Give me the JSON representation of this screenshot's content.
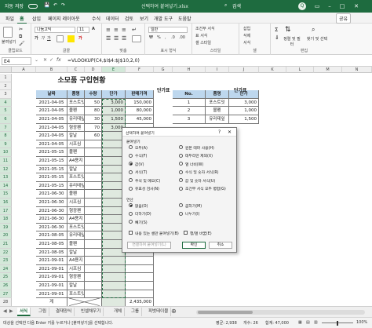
{
  "titlebar": {
    "autosave": "자동 저장",
    "filename": "선택하여 붙여넣기.xlsx",
    "search": "검색",
    "user_initial": "Q"
  },
  "menu": {
    "tabs": [
      "파일",
      "홈",
      "삽입",
      "페이지 레이아웃",
      "수식",
      "데이터",
      "검토",
      "보기",
      "개발 도구",
      "도움말"
    ],
    "active": 1,
    "share": "공유"
  },
  "ribbon": {
    "clipboard_label": "클립보드",
    "paste": "붙여넣기",
    "font_label": "글꼴",
    "font_name": "나눔고딕",
    "font_size": "11",
    "align_label": "맞춤",
    "number_label": "표시 형식",
    "number_format": "일반",
    "style_label": "스타일",
    "cond_format": "조건부 서식",
    "table_format": "표 서식",
    "cell_style": "셀 스타일",
    "cells_label": "셀",
    "insert": "삽입",
    "delete": "삭제",
    "format": "서식",
    "edit_label": "편집",
    "sort": "정렬 및 필터",
    "find": "찾기 및 선택"
  },
  "formula_bar": {
    "name_box": "E4",
    "fx": "fx",
    "formula": "=VLOOKUP(C4,$I$4:$J$10,2,0)"
  },
  "columns": [
    "A",
    "B",
    "C",
    "D",
    "E",
    "F",
    "G",
    "H",
    "I",
    "J",
    "K",
    "L",
    "M",
    "N"
  ],
  "sheet": {
    "title": "소모품 구입현황",
    "headers": [
      "날짜",
      "품명",
      "수량",
      "단가",
      "판매가격"
    ],
    "rows": [
      [
        "2021-04-05",
        "포스트잇",
        "50",
        "3,000",
        "150,000"
      ],
      [
        "2021-04-05",
        "볼펜",
        "80",
        "1,000",
        "80,000"
      ],
      [
        "2021-04-05",
        "유리테잎",
        "30",
        "1,500",
        "45,000"
      ],
      [
        "2021-04-05",
        "형광펜",
        "70",
        "3,000",
        ""
      ],
      [
        "2021-04-05",
        "칼날",
        "60",
        "",
        ""
      ],
      [
        "2021-04-05",
        "시프심",
        "",
        "",
        ""
      ],
      [
        "2021-05-15",
        "볼펜",
        "",
        "",
        ""
      ],
      [
        "2021-05-15",
        "A4용지",
        "",
        "",
        ""
      ],
      [
        "2021-05-15",
        "칼날",
        "",
        "",
        ""
      ],
      [
        "2021-05-15",
        "포스트잇",
        "",
        "",
        ""
      ],
      [
        "2021-05-15",
        "유리테잎",
        "",
        "",
        ""
      ],
      [
        "2021-06-30",
        "볼펜",
        "",
        "",
        ""
      ],
      [
        "2021-06-30",
        "시프심",
        "",
        "",
        ""
      ],
      [
        "2021-06-30",
        "형광펜",
        "",
        "",
        ""
      ],
      [
        "2021-06-30",
        "A4용지",
        "",
        "",
        ""
      ],
      [
        "2021-06-30",
        "포스트잇",
        "",
        "",
        ""
      ],
      [
        "2021-08-05",
        "유리테잎",
        "",
        "",
        ""
      ],
      [
        "2021-08-05",
        "볼펜",
        "",
        "",
        ""
      ],
      [
        "2021-08-05",
        "칼날",
        "",
        "",
        ""
      ],
      [
        "2021-09-01",
        "A4용지",
        "",
        "",
        ""
      ],
      [
        "2021-09-01",
        "시프심",
        "",
        "",
        ""
      ],
      [
        "2021-09-01",
        "형광펜",
        "",
        "",
        ""
      ],
      [
        "2021-09-01",
        "칼날",
        "",
        "",
        ""
      ],
      [
        "2021-09-01",
        "포스트잇",
        "",
        "",
        ""
      ]
    ],
    "total_label": "계",
    "total_value": "2,435,000",
    "unit_table_title": "단가표",
    "unit_headers": [
      "No.",
      "품명",
      "단가"
    ],
    "unit_rows": [
      [
        "1",
        "포스트잇",
        "3,000"
      ],
      [
        "2",
        "볼펜",
        "1,000"
      ],
      [
        "3",
        "유리테잎",
        "1,500"
      ]
    ],
    "unit_table_title2": "단가표"
  },
  "dialog": {
    "title": "선택하여 붙여넣기",
    "paste_section": "붙여넣기",
    "paste_left": [
      "모두(A)",
      "수식(F)",
      "값(V)",
      "서식(T)",
      "주석 및 메모(C)",
      "유효성 검사(N)"
    ],
    "paste_right": [
      "원본 테마 사용(H)",
      "테두리만 제외(X)",
      "열 너비(W)",
      "수식 및 숫자 서식(R)",
      "값 및 숫자 서식(U)",
      "조건부 서식 모두 병합(G)"
    ],
    "paste_selected": 2,
    "op_section": "연산",
    "op_left": [
      "없음(O)",
      "더하기(D)",
      "빼기(S)"
    ],
    "op_right": [
      "곱하기(M)",
      "나누기(I)"
    ],
    "op_selected": 0,
    "skip_blanks": "내용 있는 셀만 붙여넣기(B)",
    "transpose": "행/열 바꿈(E)",
    "paste_link": "연결하여 붙여넣기(L)",
    "ok": "확인",
    "cancel": "취소"
  },
  "sheet_tabs": [
    "서식",
    "그림",
    "결재양식",
    "빈셀채우기",
    "개체",
    "그룹",
    "피벗테이블"
  ],
  "sheet_tab_active": 0,
  "status": {
    "left": "대상을 선택한 다음 Enter 키를 누르거나 [붙여넣기]를 선택합니다.",
    "avg": "평균: 2,938",
    "count": "개수: 26",
    "sum": "합계: 47,000",
    "zoom": "100%"
  }
}
